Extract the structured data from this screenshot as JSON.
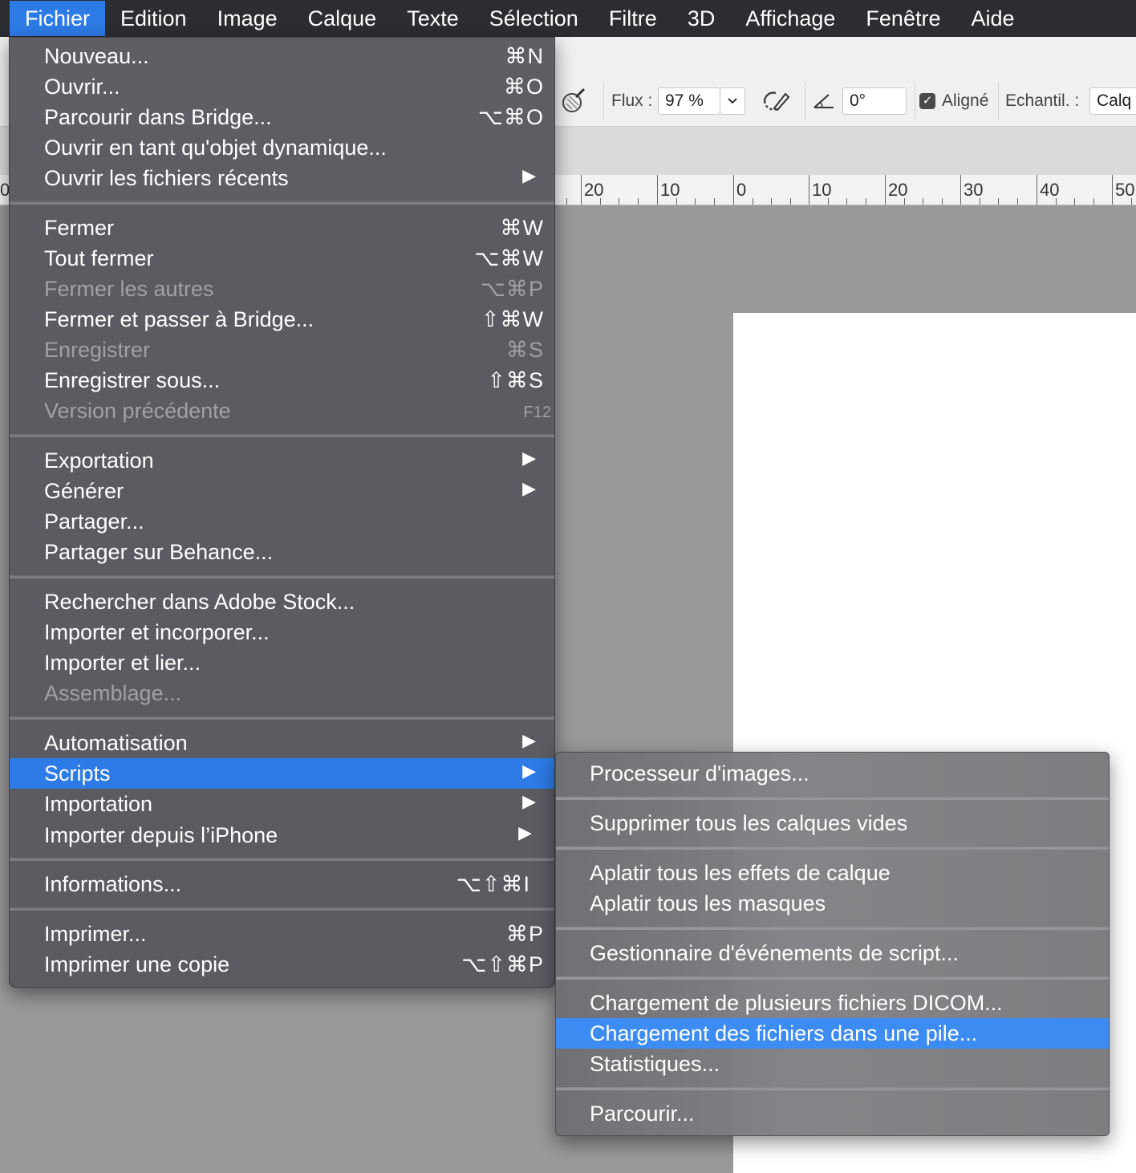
{
  "menubar": {
    "items": [
      "Fichier",
      "Edition",
      "Image",
      "Calque",
      "Texte",
      "Sélection",
      "Filtre",
      "3D",
      "Affichage",
      "Fenêtre",
      "Aide"
    ],
    "active": "Fichier"
  },
  "options": {
    "flux_label": "Flux :",
    "flux_value": "97 %",
    "angle_value": "0°",
    "aligned_label": "Aligné",
    "sample_label": "Echantil. :",
    "sample_value": "Calq"
  },
  "ruler": {
    "labels": [
      "0",
      "20",
      "10",
      "0",
      "10",
      "20",
      "30",
      "40",
      "50"
    ]
  },
  "file_menu": {
    "items": [
      {
        "label": "Nouveau...",
        "shortcut": "⌘N"
      },
      {
        "label": "Ouvrir...",
        "shortcut": "⌘O"
      },
      {
        "label": "Parcourir dans Bridge...",
        "shortcut": "⌥⌘O"
      },
      {
        "label": "Ouvrir en tant qu'objet dynamique..."
      },
      {
        "label": "Ouvrir les fichiers récents",
        "submenu": true
      },
      {
        "label": "Fermer",
        "shortcut": "⌘W"
      },
      {
        "label": "Tout fermer",
        "shortcut": "⌥⌘W"
      },
      {
        "label": "Fermer les autres",
        "shortcut": "⌥⌘P",
        "disabled": true
      },
      {
        "label": "Fermer et passer à Bridge...",
        "shortcut": "⇧⌘W"
      },
      {
        "label": "Enregistrer",
        "shortcut": "⌘S",
        "disabled": true
      },
      {
        "label": "Enregistrer sous...",
        "shortcut": "⇧⌘S"
      },
      {
        "label": "Version précédente",
        "shortcut": "F12",
        "disabled": true
      },
      {
        "label": "Exportation",
        "submenu": true
      },
      {
        "label": "Générer",
        "submenu": true
      },
      {
        "label": "Partager..."
      },
      {
        "label": "Partager sur Behance..."
      },
      {
        "label": "Rechercher dans Adobe Stock..."
      },
      {
        "label": "Importer et incorporer..."
      },
      {
        "label": "Importer et lier..."
      },
      {
        "label": "Assemblage...",
        "disabled": true
      },
      {
        "label": "Automatisation",
        "submenu": true
      },
      {
        "label": "Scripts",
        "submenu": true,
        "highlighted": true
      },
      {
        "label": "Importation",
        "submenu": true
      },
      {
        "label": "Importer depuis l’iPhone",
        "submenu": true
      },
      {
        "label": "Informations...",
        "shortcut": "⌥⇧⌘I"
      },
      {
        "label": "Imprimer...",
        "shortcut": "⌘P"
      },
      {
        "label": "Imprimer une copie",
        "shortcut": "⌥⇧⌘P"
      }
    ]
  },
  "scripts_submenu": {
    "items": [
      {
        "label": "Processeur d'images..."
      },
      {
        "label": "Supprimer tous les calques vides"
      },
      {
        "label": "Aplatir tous les effets de calque"
      },
      {
        "label": "Aplatir tous les masques"
      },
      {
        "label": "Gestionnaire d'événements de script..."
      },
      {
        "label": "Chargement de plusieurs fichiers DICOM..."
      },
      {
        "label": "Chargement des fichiers dans une pile...",
        "highlighted": true
      },
      {
        "label": "Statistiques..."
      },
      {
        "label": "Parcourir..."
      }
    ]
  },
  "colors": {
    "accent": "#2d7be6",
    "menubar_bg": "#2c2d31",
    "menu_bg": "#585a60",
    "disabled_text": "#9fa1a6"
  }
}
